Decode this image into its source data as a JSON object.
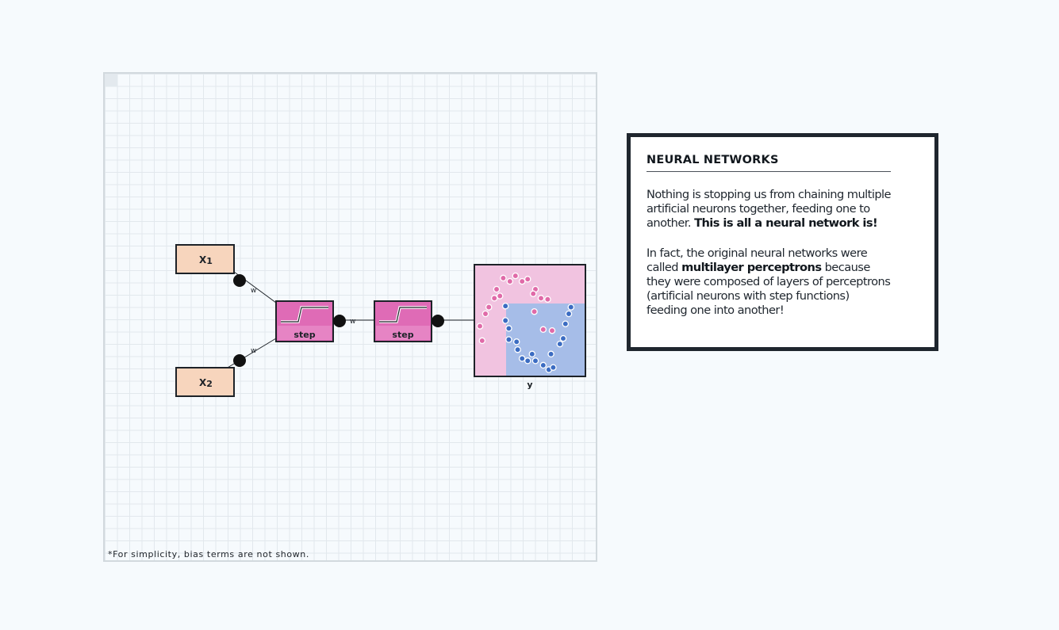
{
  "diagram": {
    "inputs": [
      {
        "label": "X",
        "subscript": "1"
      },
      {
        "label": "X",
        "subscript": "2"
      }
    ],
    "weight_label": "w",
    "neurons": [
      {
        "label": "step"
      },
      {
        "label": "step"
      }
    ],
    "output_label": "y",
    "footnote": "*For simplicity, bias terms are not shown.",
    "colors": {
      "input_fill": "#f7d5bd",
      "neuron_fill": "#df6bb6",
      "output_pink": "#f1c3e0",
      "output_blue": "#a6bde8",
      "point_pink": "#e06aa8",
      "point_blue": "#3b6cc2",
      "connector": "#111111"
    },
    "pink_points": [
      [
        0.26,
        0.12
      ],
      [
        0.37,
        0.1
      ],
      [
        0.43,
        0.15
      ],
      [
        0.48,
        0.13
      ],
      [
        0.55,
        0.22
      ],
      [
        0.2,
        0.22
      ],
      [
        0.18,
        0.3
      ],
      [
        0.13,
        0.38
      ],
      [
        0.1,
        0.44
      ],
      [
        0.23,
        0.28
      ],
      [
        0.6,
        0.3
      ],
      [
        0.66,
        0.31
      ],
      [
        0.05,
        0.55
      ],
      [
        0.07,
        0.68
      ],
      [
        0.54,
        0.42
      ],
      [
        0.62,
        0.58
      ],
      [
        0.7,
        0.59
      ],
      [
        0.53,
        0.26
      ],
      [
        0.32,
        0.15
      ]
    ],
    "blue_points": [
      [
        0.28,
        0.37
      ],
      [
        0.28,
        0.5
      ],
      [
        0.31,
        0.57
      ],
      [
        0.31,
        0.67
      ],
      [
        0.38,
        0.69
      ],
      [
        0.39,
        0.76
      ],
      [
        0.43,
        0.84
      ],
      [
        0.48,
        0.86
      ],
      [
        0.52,
        0.8
      ],
      [
        0.55,
        0.86
      ],
      [
        0.62,
        0.9
      ],
      [
        0.67,
        0.94
      ],
      [
        0.69,
        0.8
      ],
      [
        0.77,
        0.71
      ],
      [
        0.8,
        0.66
      ],
      [
        0.82,
        0.53
      ],
      [
        0.85,
        0.44
      ],
      [
        0.87,
        0.38
      ],
      [
        0.71,
        0.92
      ]
    ]
  },
  "card": {
    "title": "NEURAL NETWORKS",
    "para1_text": "Nothing is stopping us from chaining multiple artificial neurons together, feeding one to another. ",
    "para1_bold": "This is all a neural network is!",
    "para2_text_a": "In fact, the original neural networks were called ",
    "para2_bold": "multilayer perceptrons",
    "para2_text_b": " because they were composed of layers of perceptrons (artificial neurons with step functions) feeding one into another!"
  }
}
